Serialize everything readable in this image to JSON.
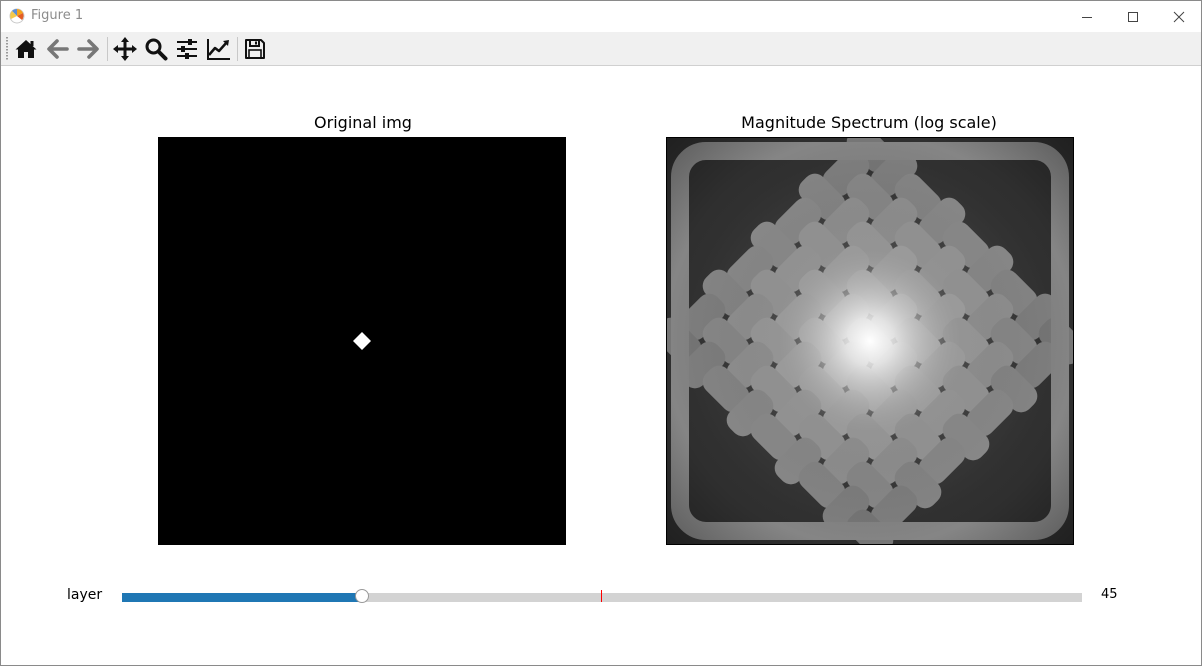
{
  "window": {
    "title": "Figure 1"
  },
  "toolbar": {
    "tools": [
      {
        "name": "home-icon"
      },
      {
        "name": "back-icon"
      },
      {
        "name": "forward-icon"
      },
      {
        "name": "pan-icon"
      },
      {
        "name": "zoom-icon"
      },
      {
        "name": "configure-subplots-icon"
      },
      {
        "name": "edit-axis-icon"
      },
      {
        "name": "save-icon"
      }
    ]
  },
  "plots": {
    "left_title": "Original img",
    "right_title": "Magnitude Spectrum (log scale)"
  },
  "slider": {
    "label": "layer",
    "value_text": "45",
    "fill_fraction": 0.25,
    "valinit_fraction": 0.5,
    "fill_color": "#1f77b4",
    "valinit_color": "#ff0000"
  }
}
